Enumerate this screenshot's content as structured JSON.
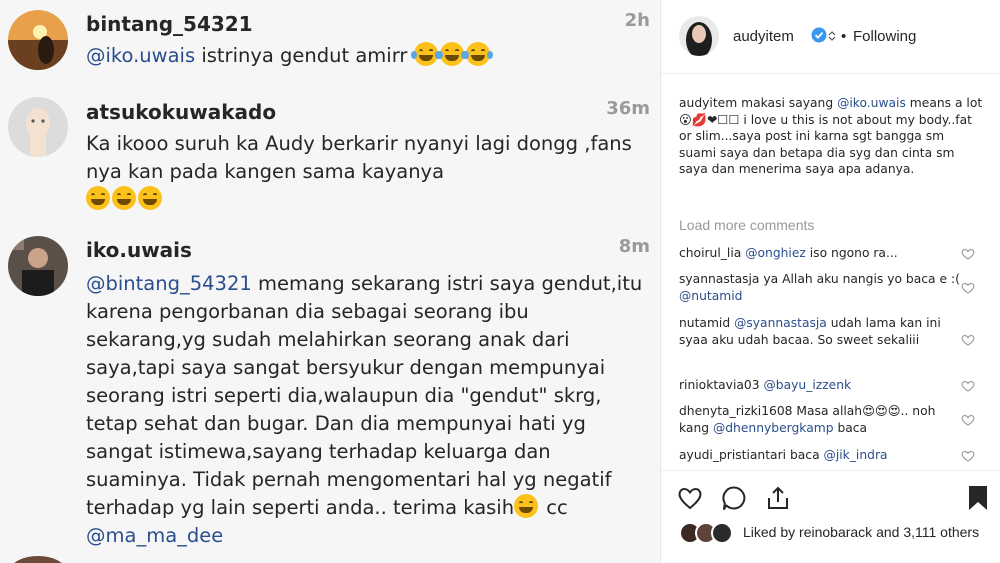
{
  "left_panel": {
    "comments": [
      {
        "username": "bintang_54321",
        "time": "2h",
        "mention": "@iko.uwais",
        "text": " istrinya gendut amirr ",
        "emoji": "face-with-tears-of-joy x3"
      },
      {
        "username": "atsukokuwakado",
        "time": "36m",
        "text": "Ka ikooo suruh ka Audy berkarir nyanyi lagi dongg ,fans nya kan pada kangen sama kayanya",
        "emoji": "grinning-face x3"
      },
      {
        "username": "iko.uwais",
        "time": "8m",
        "mention": "@bintang_54321",
        "text": " memang sekarang istri saya gendut,itu karena pengorbanan dia sebagai seorang ibu sekarang,yg sudah melahirkan seorang anak dari saya,tapi saya sangat bersyukur dengan mempunyai seorang istri seperti dia,walaupun dia \"gendut\" skrg, tetap sehat dan bugar. Dan dia mempunyai hati yg sangat istimewa,sayang terhadap keluarga dan suaminya. Tidak pernah mengomentari hal yg negatif terhadap yg lain seperti anda.. terima kasih",
        "cc": " cc ",
        "mention2": "@ma_ma_dee",
        "emoji": "smiling-face"
      }
    ]
  },
  "post": {
    "username": "audyitem",
    "follow_dot": "•",
    "follow_label": "Following",
    "caption": {
      "username": "audyitem",
      "pre": " makasi sayang ",
      "mention": "@iko.uwais",
      "post": " means a lot 😮💋❤☐☐ i love u this is not about my body..fat or slim...saya post ini karna sgt bangga sm suami saya dan betapa dia syg dan cinta sm saya dan menerima saya apa adanya."
    },
    "load_more": "Load more comments",
    "comments": [
      {
        "user": "choirul_lia",
        "pre": " ",
        "mention": "@onghiez",
        "post": " iso ngono ra..."
      },
      {
        "user": "syannastasja",
        "pre": " ya Allah aku nangis yo baca e :( ",
        "mention": "@nutamid",
        "post": ""
      },
      {
        "user": "nutamid",
        "pre": " ",
        "mention": "@syannastasja",
        "post": " udah lama kan ini syaa aku udah bacaa. So sweet sekaliii"
      },
      {
        "user": "rinioktavia03",
        "pre": " ",
        "mention": "@bayu_izzenk",
        "post": ""
      },
      {
        "user": "dhenyta_rizki1608",
        "pre": " Masa allah😍😍😍.. noh kang ",
        "mention": "@dhennybergkamp",
        "post": " baca"
      },
      {
        "user": "ayudi_pristiantari",
        "pre": " baca ",
        "mention": "@jik_indra",
        "post": ""
      }
    ],
    "liked_by": "Liked by reinobarack and 3,111 others"
  }
}
